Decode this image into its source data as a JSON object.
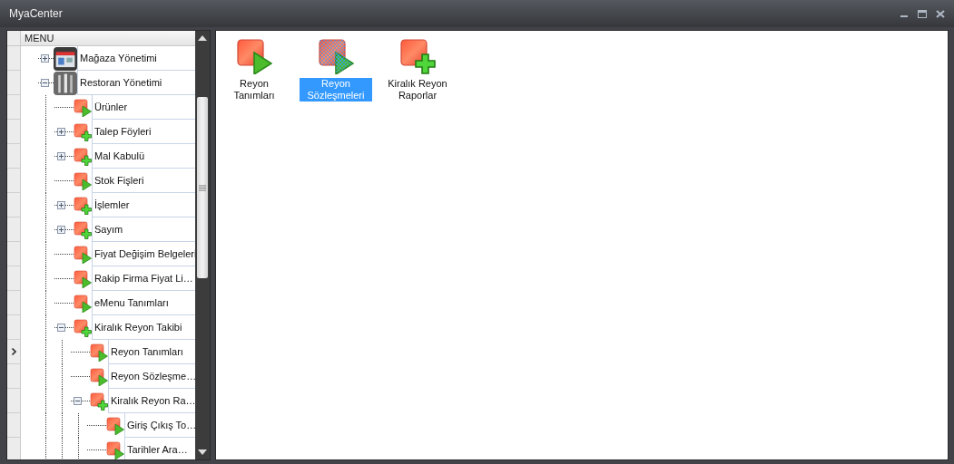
{
  "window": {
    "title": "MyaCenter"
  },
  "menu": {
    "header": "MENU",
    "items": [
      {
        "label": "Mağaza Yönetimi",
        "kind": "shop",
        "expanded": false,
        "selected": false
      },
      {
        "label": "Restoran Yönetimi",
        "kind": "cutlery",
        "expanded": true,
        "selected": false,
        "children": [
          {
            "label": "Ürünler",
            "kind": "play",
            "selected": false
          },
          {
            "label": "Talep Föyleri",
            "kind": "plus",
            "expanded": false,
            "selected": false
          },
          {
            "label": "Mal Kabulü",
            "kind": "plus",
            "expanded": false,
            "selected": false
          },
          {
            "label": "Stok Fişleri",
            "kind": "play",
            "selected": false
          },
          {
            "label": "İşlemler",
            "kind": "plus",
            "expanded": false,
            "selected": false
          },
          {
            "label": "Sayım",
            "kind": "plus",
            "expanded": false,
            "selected": false
          },
          {
            "label": "Fiyat Değişim Belgeleri",
            "kind": "play",
            "selected": false
          },
          {
            "label": "Rakip Firma Fiyat Li…",
            "kind": "play",
            "selected": false
          },
          {
            "label": "eMenu Tanımları",
            "kind": "play",
            "selected": false
          },
          {
            "label": "Kiralık Reyon Takibi",
            "kind": "plus",
            "expanded": true,
            "selected": false,
            "children": [
              {
                "label": "Reyon Tanımları",
                "kind": "play",
                "selected": true
              },
              {
                "label": "Reyon Sözleşme…",
                "kind": "play",
                "selected": false
              },
              {
                "label": "Kiralık Reyon Ra…",
                "kind": "plus",
                "expanded": true,
                "selected": false,
                "children": [
                  {
                    "label": "Giriş Çıkış To…",
                    "kind": "play",
                    "selected": false
                  },
                  {
                    "label": "Tarihler Ara…",
                    "kind": "play",
                    "selected": false
                  }
                ]
              }
            ]
          }
        ]
      }
    ]
  },
  "content": {
    "items": [
      {
        "label": "Reyon Tanımları",
        "kind": "play",
        "selected": false
      },
      {
        "label": "Reyon Sözleşmeleri",
        "kind": "play",
        "selected": true
      },
      {
        "label": "Kiralık Reyon Raporlar",
        "kind": "plus",
        "selected": false
      }
    ]
  }
}
